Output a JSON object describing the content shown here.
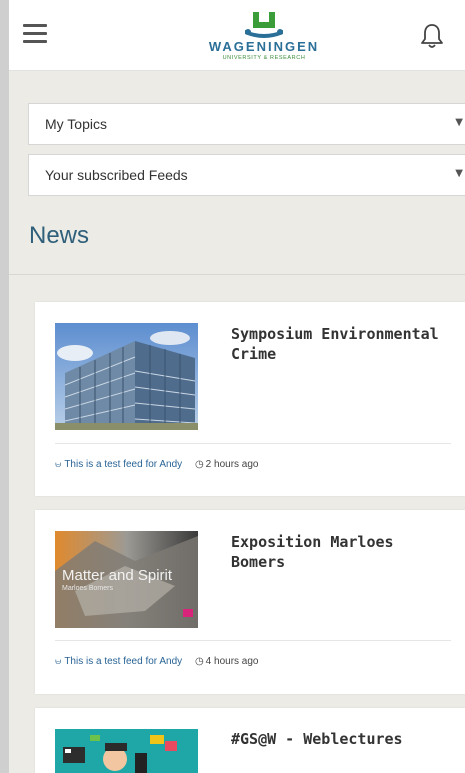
{
  "header": {
    "logo_word": "WAGENINGEN",
    "logo_sub": "UNIVERSITY & RESEARCH"
  },
  "filters": {
    "topics_label": "My Topics",
    "feeds_label": "Your subscribed Feeds"
  },
  "section_title": "News",
  "news": [
    {
      "title": "Symposium Environmental Crime",
      "feed": "This is a test feed for Andy",
      "time": "2 hours ago",
      "thumb_text": ""
    },
    {
      "title": "Exposition Marloes Bomers",
      "feed": "This is a test feed for Andy",
      "time": "4 hours ago",
      "thumb_text": "Matter and Spirit",
      "thumb_subtext": "Marloes Bomers"
    },
    {
      "title": "#GS@W - Weblectures",
      "feed": "",
      "time": "",
      "thumb_text": ""
    }
  ],
  "colors": {
    "accent": "#2f5f7a",
    "link": "#2a6496",
    "logo_green": "#3a9d3a"
  },
  "icons": {
    "menu": "hamburger-icon",
    "bell": "bell-icon",
    "rss": "rss-icon",
    "clock": "clock-icon",
    "chevron": "chevron-down-icon"
  }
}
